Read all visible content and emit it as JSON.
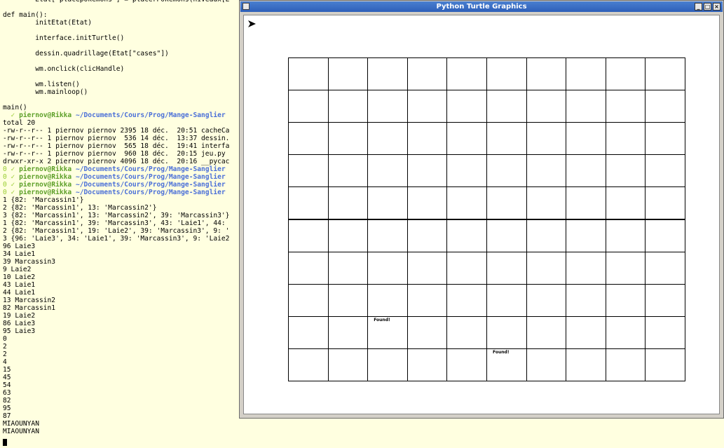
{
  "terminal": {
    "lines": [
      "        Etat[\"placepokemons\"] = placerPokemons(niveaux[E",
      "",
      "def main():",
      "        initEtat(Etat)",
      "",
      "        interface.initTurtle()",
      "",
      "        dessin.quadrillage(Etat[\"cases\"])",
      "",
      "        wm.onclick(clicHandle)",
      "",
      "        wm.listen()",
      "        wm.mainloop()",
      "",
      "main()",
      "",
      "total 20",
      "-rw-r--r-- 1 piernov piernov 2395 18 déc.  20:51 cacheCa",
      "-rw-r--r-- 1 piernov piernov  536 14 déc.  13:37 dessin.",
      "-rw-r--r-- 1 piernov piernov  565 18 déc.  19:41 interfa",
      "-rw-r--r-- 1 piernov piernov  960 18 déc.  20:15 jeu.py",
      "drwxr-xr-x 2 piernov piernov 4096 18 déc.  20:16 __pycac",
      "",
      "",
      "",
      "",
      "1 {82: 'Marcassin1'}",
      "2 {82: 'Marcassin1', 13: 'Marcassin2'}",
      "3 {82: 'Marcassin1', 13: 'Marcassin2', 39: 'Marcassin3'}",
      "1 {82: 'Marcassin1', 39: 'Marcassin3', 43: 'Laie1', 44:",
      "2 {82: 'Marcassin1', 19: 'Laie2', 39: 'Marcassin3', 9: '",
      "3 {96: 'Laie3', 34: 'Laie1', 39: 'Marcassin3', 9: 'Laie2",
      "96 Laie3",
      "34 Laie1",
      "39 Marcassin3",
      "9 Laie2",
      "10 Laie2",
      "43 Laie1",
      "44 Laie1",
      "13 Marcassin2",
      "82 Marcassin1",
      "19 Laie2",
      "86 Laie3",
      "95 Laie3",
      "0",
      "2",
      "2",
      "4",
      "15",
      "45",
      "54",
      "63",
      "82",
      "95",
      "87",
      "MIAOUNYAN",
      "MIAOUNYAN"
    ],
    "prompts": [
      {
        "line": 15,
        "dim": "  ✓ ",
        "user": "piernov@Rikka",
        "path": " ~/Documents/Cours/Prog/Mange-Sanglier"
      },
      {
        "line": 22,
        "dim": "0 ✓ ",
        "user": "piernov@Rikka",
        "path": " ~/Documents/Cours/Prog/Mange-Sanglier"
      },
      {
        "line": 23,
        "dim": "0 ✓ ",
        "user": "piernov@Rikka",
        "path": " ~/Documents/Cours/Prog/Mange-Sanglier"
      },
      {
        "line": 24,
        "dim": "0 ✓ ",
        "user": "piernov@Rikka",
        "path": " ~/Documents/Cours/Prog/Mange-Sanglier"
      },
      {
        "line": 25,
        "dim": "0 ✓ ",
        "user": "piernov@Rikka",
        "path": " ~/Documents/Cours/Prog/Mange-Sanglier"
      }
    ]
  },
  "turtle_window": {
    "title": "Python Turtle Graphics",
    "minimize_label": "_",
    "maximize_label": "□",
    "close_label": "×",
    "grid": {
      "rows": 10,
      "cols": 10
    },
    "found_label": "Found!",
    "found_cells": [
      {
        "row": 8,
        "col": 2
      },
      {
        "row": 9,
        "col": 5
      }
    ]
  }
}
